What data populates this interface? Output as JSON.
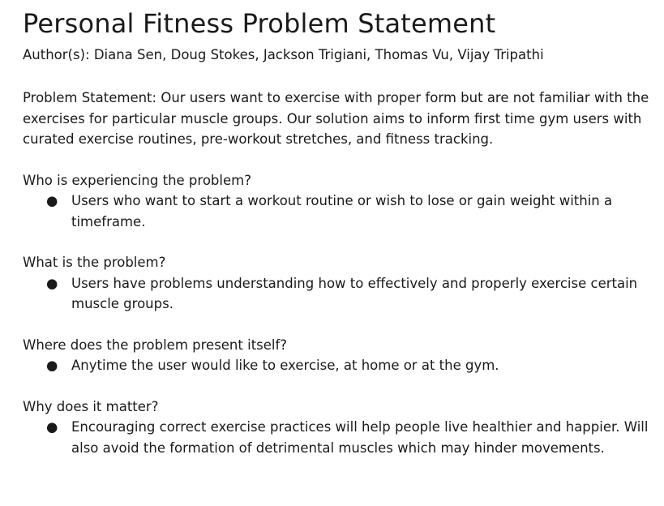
{
  "document": {
    "title": "Personal Fitness Problem Statement",
    "authors": "Author(s): Diana Sen, Doug Stokes, Jackson Trigiani, Thomas Vu, Vijay Tripathi",
    "statement": "Problem Statement: Our users want to exercise with proper form but are not familiar with the exercises for particular muscle groups. Our solution aims to inform first time gym users with curated exercise routines, pre-workout stretches, and fitness tracking.",
    "bullet_char": "●",
    "sections": [
      {
        "question": "Who is experiencing the problem?",
        "answer": "Users who want to start a workout routine or wish to lose or gain weight within a timeframe."
      },
      {
        "question": "What is the problem?",
        "answer": "Users have problems understanding how to effectively and properly exercise certain muscle groups."
      },
      {
        "question": "Where does the problem present itself?",
        "answer": "Anytime the user would like to exercise, at home or at the gym."
      },
      {
        "question": "Why does it matter?",
        "answer": "Encouraging correct exercise practices will help people live healthier and happier. Will also avoid the formation of detrimental muscles which may hinder movements."
      }
    ]
  }
}
